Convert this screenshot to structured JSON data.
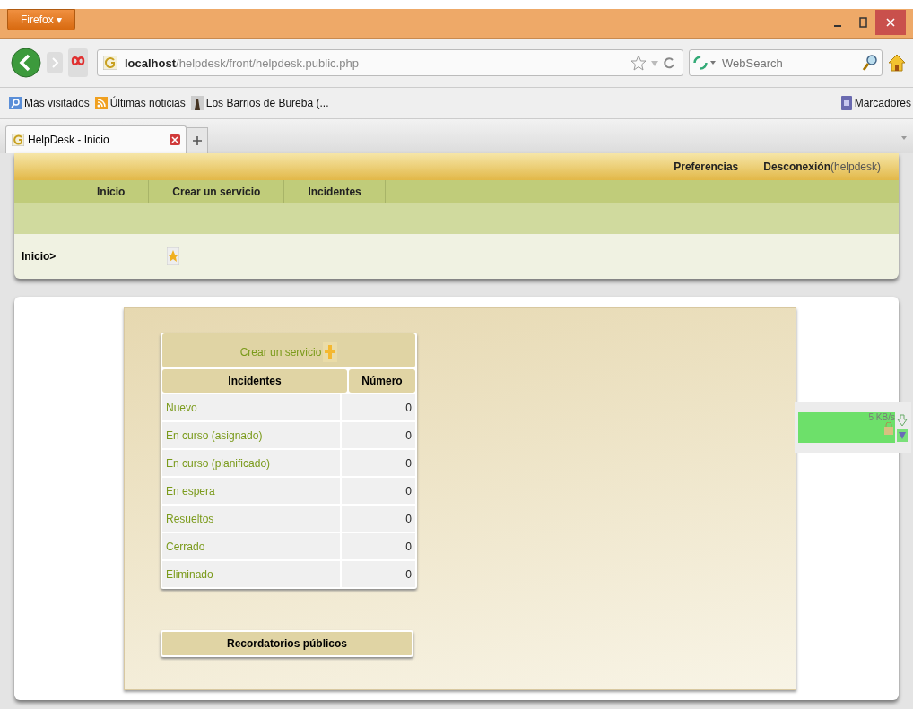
{
  "browser": {
    "menu_button": "Firefox ▾",
    "address": {
      "host": "localhost",
      "path": "/helpdesk/front/helpdesk.public.php"
    },
    "search": {
      "placeholder": "WebSearch"
    },
    "bookmarks": [
      {
        "label": "Más visitados",
        "kind": "search"
      },
      {
        "label": "Últimas noticias",
        "kind": "feed"
      },
      {
        "label": "Los Barrios de Bureba (...",
        "kind": "photo"
      }
    ],
    "bookmarks_menu": "Marcadores",
    "tabs": [
      {
        "label": "HelpDesk - Inicio",
        "selected": true
      }
    ]
  },
  "header": {
    "links": [
      {
        "label": "Preferencias"
      },
      {
        "label": "Desconexión",
        "extra": "(helpdesk)"
      }
    ],
    "menu": [
      {
        "label": "Inicio"
      },
      {
        "label": "Crear un servicio"
      },
      {
        "label": "Incidentes"
      }
    ],
    "breadcrumb": "Inicio>"
  },
  "panel": {
    "create_link": "Crear un servicio",
    "columns": [
      "Incidentes",
      "Número"
    ],
    "rows": [
      {
        "status": "Nuevo",
        "count": "0"
      },
      {
        "status": "En curso (asignado)",
        "count": "0"
      },
      {
        "status": "En curso (planificado)",
        "count": "0"
      },
      {
        "status": "En espera",
        "count": "0"
      },
      {
        "status": "Resueltos",
        "count": "0"
      },
      {
        "status": "Cerrado",
        "count": "0"
      },
      {
        "status": "Eliminado",
        "count": "0"
      }
    ],
    "reminders_title": "Recordatorios públicos"
  },
  "speed_widget": {
    "reading": "5 KB/s"
  }
}
